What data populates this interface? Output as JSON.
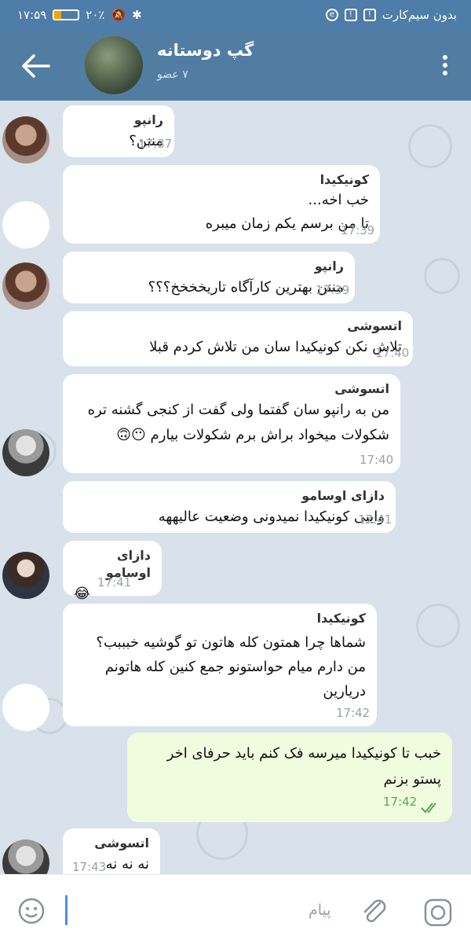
{
  "statusbar": {
    "time": "۱۷:۵۹",
    "battery": "۲۰٪",
    "battery_level": 0.2,
    "carrier": "بدون سیم‌کارت"
  },
  "header": {
    "title": "گپ دوستانه",
    "subtitle": "۷ عضو",
    "icons": [
      "back-arrow-icon",
      "menu-dots-icon"
    ]
  },
  "messages": [
    {
      "sender": "رانپو",
      "text": "مننن؟",
      "time": "17:37",
      "avatar": "ranpo"
    },
    {
      "sender": "کونیکیدا",
      "text": "خب اخه...\nتا من برسم یکم زمان میبره",
      "time": "17:39",
      "avatar": "blank"
    },
    {
      "sender": "رانپو",
      "text": "مننن بهترین کارآگاه تاریخخخخ؟؟؟",
      "time": "17:39",
      "avatar": "ranpo"
    },
    {
      "sender": "اتسوشی",
      "text": "تلاش نکن کونیکیدا سان من تلاش کردم قبلا",
      "time": "17:40"
    },
    {
      "sender": "اتسوشی",
      "text": "من به رانپو سان گفتما ولی گفت از کنجی گشنه تره\nشکولات میخواد براش برم شکولات بیارم 😶🙃",
      "time": "17:40",
      "avatar": "atsushi"
    },
    {
      "sender": "دازای اوسامو",
      "text": "واییی کونیکیدا نمیدونی وضعیت عالیههه",
      "time": "17:41"
    },
    {
      "sender": "دازای اوسامو",
      "text": "😂",
      "time": "17:41",
      "avatar": "dazai"
    },
    {
      "sender": "کونیکیدا",
      "text": "شماها چرا همتون کله هاتون تو گوشیه خبببب؟\nمن دارم میام حواستونو جمع کنین کله هاتونم\nدریارین",
      "time": "17:42",
      "avatar": "blank"
    },
    {
      "text": "خبب تا کونیکیدا میرسه فک کنم باید حرفای اخر\nپستو بزنم",
      "time": "17:42",
      "outgoing": true
    },
    {
      "sender": "اتسوشی",
      "text": "نه نه نه",
      "time": "17:43",
      "avatar": "atsushi"
    }
  ],
  "input": {
    "placeholder": "پیام",
    "icons": [
      "emoji-icon",
      "attach-icon",
      "camera-icon"
    ]
  }
}
